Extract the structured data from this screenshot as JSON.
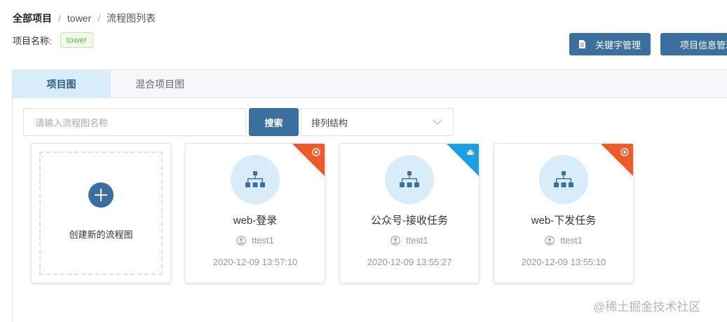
{
  "breadcrumb": {
    "root": "全部项目",
    "sep": "/",
    "project": "tower",
    "current": "流程图列表"
  },
  "project": {
    "label": "项目名称:",
    "tag": "tower"
  },
  "buttons": {
    "keyword": "关键字管理",
    "info": "项目信息管理"
  },
  "tabs": [
    {
      "label": "项目图",
      "active": true
    },
    {
      "label": "混合项目图",
      "active": false
    }
  ],
  "search": {
    "placeholder": "请输入流程图名称",
    "button": "搜索"
  },
  "sort": {
    "value": "排列结构"
  },
  "create_card": {
    "label": "创建新的流程图"
  },
  "cards": [
    {
      "title": "web-登录",
      "user": "ttest1",
      "time": "2020-12-09 13:57:10",
      "platform_icon": "chrome-icon",
      "corner_color": "#f05a28"
    },
    {
      "title": "公众号-接收任务",
      "user": "ttest1",
      "time": "2020-12-09 13:55:27",
      "platform_icon": "android-icon",
      "corner_color": "#1ba1e2"
    },
    {
      "title": "web-下发任务",
      "user": "ttest1",
      "time": "2020-12-09 13:55:10",
      "platform_icon": "chrome-icon",
      "corner_color": "#f05a28"
    }
  ],
  "watermark": "@稀土掘金技术社区",
  "colors": {
    "primary": "#3a6f9f",
    "tab_active_bg": "#d9ecfa",
    "tag_green": "#67c23a"
  }
}
